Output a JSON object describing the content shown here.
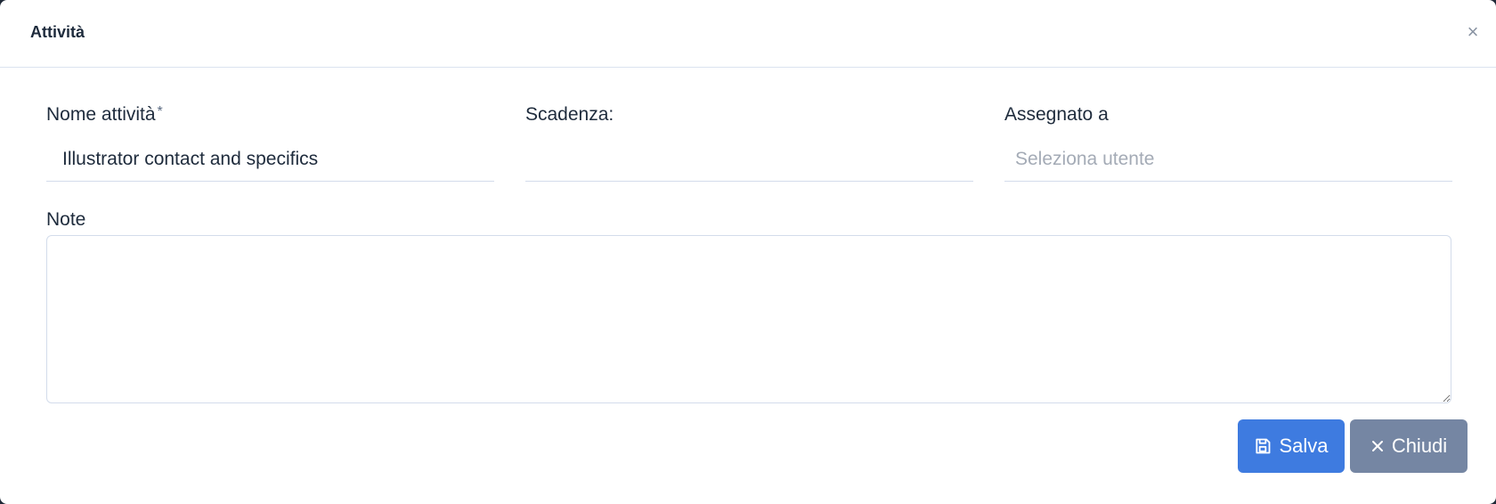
{
  "dialog": {
    "title": "Attività",
    "close_icon": "close-icon"
  },
  "form": {
    "name": {
      "label": "Nome attività",
      "required_mark": "*",
      "value": "Illustrator contact and specifics"
    },
    "due": {
      "label": "Scadenza:",
      "value": ""
    },
    "assignee": {
      "label": "Assegnato a",
      "placeholder": "Seleziona utente"
    },
    "notes": {
      "label": "Note",
      "value": ""
    }
  },
  "actions": {
    "save_label": "Salva",
    "save_icon": "floppy-disk-icon",
    "close_label": "Chiudi",
    "close_icon": "x-icon",
    "save_color": "#3e7be0",
    "close_color": "#7586a3"
  }
}
